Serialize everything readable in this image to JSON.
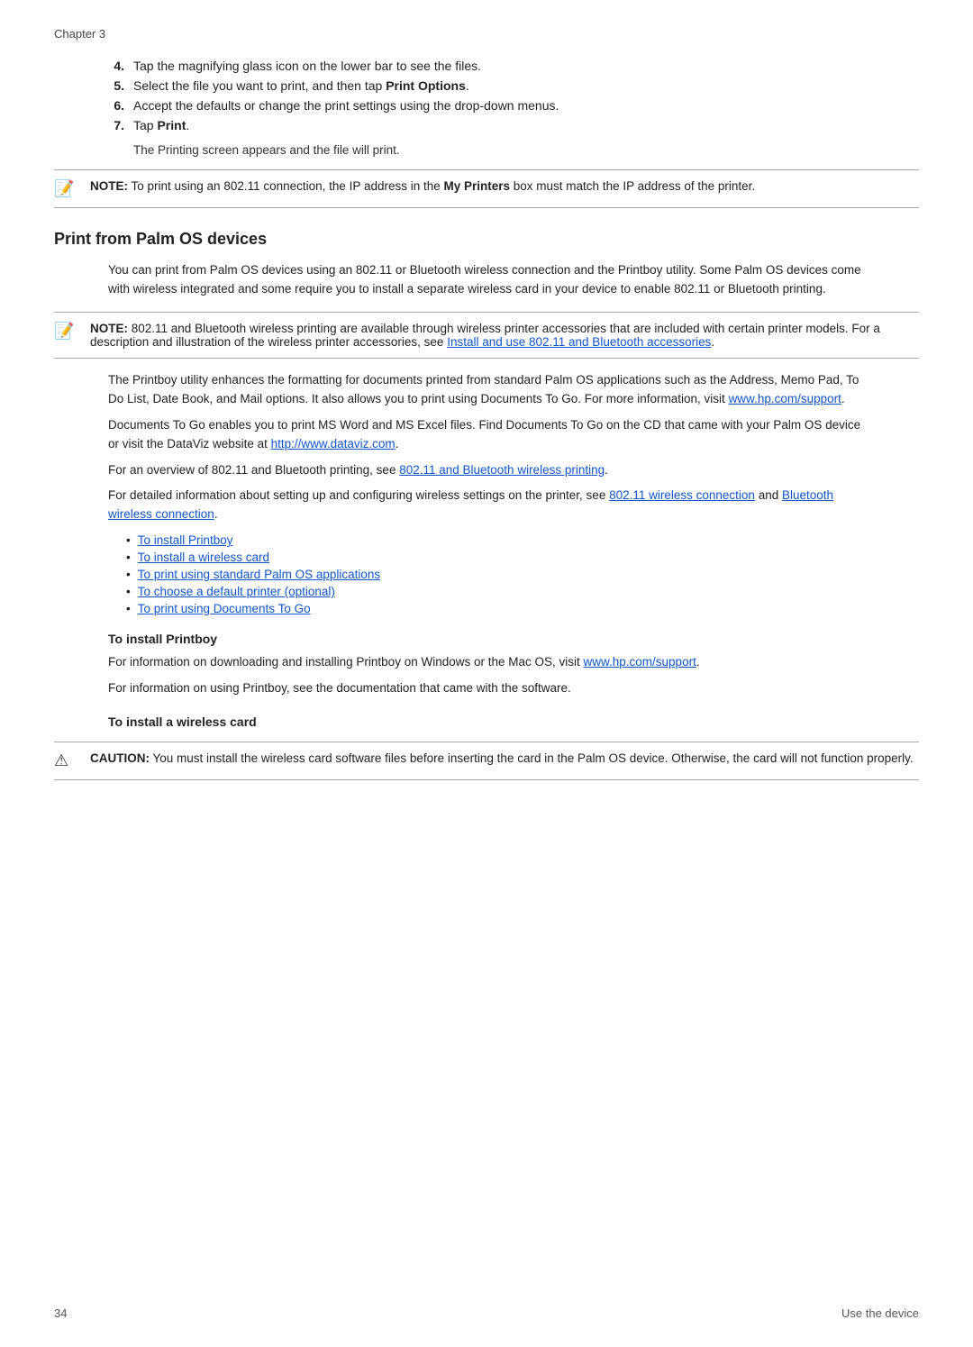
{
  "chapter": "Chapter 3",
  "numbered_steps": [
    {
      "num": "4.",
      "text": "Tap the magnifying glass icon on the lower bar to see the files."
    },
    {
      "num": "5.",
      "text_before": "Select the file you want to print, and then tap ",
      "bold": "Print Options",
      "text_after": "."
    },
    {
      "num": "6.",
      "text": "Accept the defaults or change the print settings using the drop-down menus."
    },
    {
      "num": "7.",
      "bold": "Print",
      "text_before": "Tap ",
      "text_after": "."
    }
  ],
  "sub_text": "The Printing screen appears and the file will print.",
  "note1": {
    "label": "NOTE:",
    "text": "To print using an 802.11 connection, the IP address in the ",
    "bold": "My Printers",
    "text_after": " box must match the IP address of the printer."
  },
  "section_title": "Print from Palm OS devices",
  "body1": "You can print from Palm OS devices using an 802.11 or Bluetooth wireless connection and the Printboy utility. Some Palm OS devices come with wireless integrated and some require you to install a separate wireless card in your device to enable 802.11 or Bluetooth printing.",
  "note2": {
    "label": "NOTE:",
    "text": "802.11 and Bluetooth wireless printing are available through wireless printer accessories that are included with certain printer models. For a description and illustration of the wireless printer accessories, see ",
    "link_text": "Install and use 802.11 and Bluetooth accessories",
    "text_after": "."
  },
  "body2": "The Printboy utility enhances the formatting for documents printed from standard Palm OS applications such as the Address, Memo Pad, To Do List, Date Book, and Mail options. It also allows you to print using Documents To Go. For more information, visit ",
  "link2": "www.hp.com/support",
  "body2_after": ".",
  "body3": "Documents To Go enables you to print MS Word and MS Excel files. Find Documents To Go on the CD that came with your Palm OS device or visit the DataViz website at ",
  "link3": "http://www.dataviz.com",
  "body3_after": ".",
  "body4_before": "For an overview of 802.11 and Bluetooth printing, see ",
  "link4": "802.11 and Bluetooth wireless printing",
  "body4_after": ".",
  "body5_before": "For detailed information about setting up and configuring wireless settings on the printer, see ",
  "link5a": "802.11 wireless connection",
  "body5_and": " and ",
  "link5b": "Bluetooth wireless connection",
  "body5_after": ".",
  "bullets": [
    {
      "text": "To install Printboy",
      "link": true
    },
    {
      "text": "To install a wireless card",
      "link": true
    },
    {
      "text": "To print using standard Palm OS applications",
      "link": true
    },
    {
      "text": "To choose a default printer (optional)",
      "link": true
    },
    {
      "text": "To print using Documents To Go",
      "link": true
    }
  ],
  "sub1_title": "To install Printboy",
  "sub1_body1_before": "For information on downloading and installing Printboy on Windows or the Mac OS, visit ",
  "sub1_link": "www.hp.com/support",
  "sub1_body1_after": ".",
  "sub1_body2": "For information on using Printboy, see the documentation that came with the software.",
  "sub2_title": "To install a wireless card",
  "caution": {
    "label": "CAUTION:",
    "text": "You must install the wireless card software files before inserting the card in the Palm OS device. Otherwise, the card will not function properly."
  },
  "footer_page": "34",
  "footer_text": "Use the device"
}
